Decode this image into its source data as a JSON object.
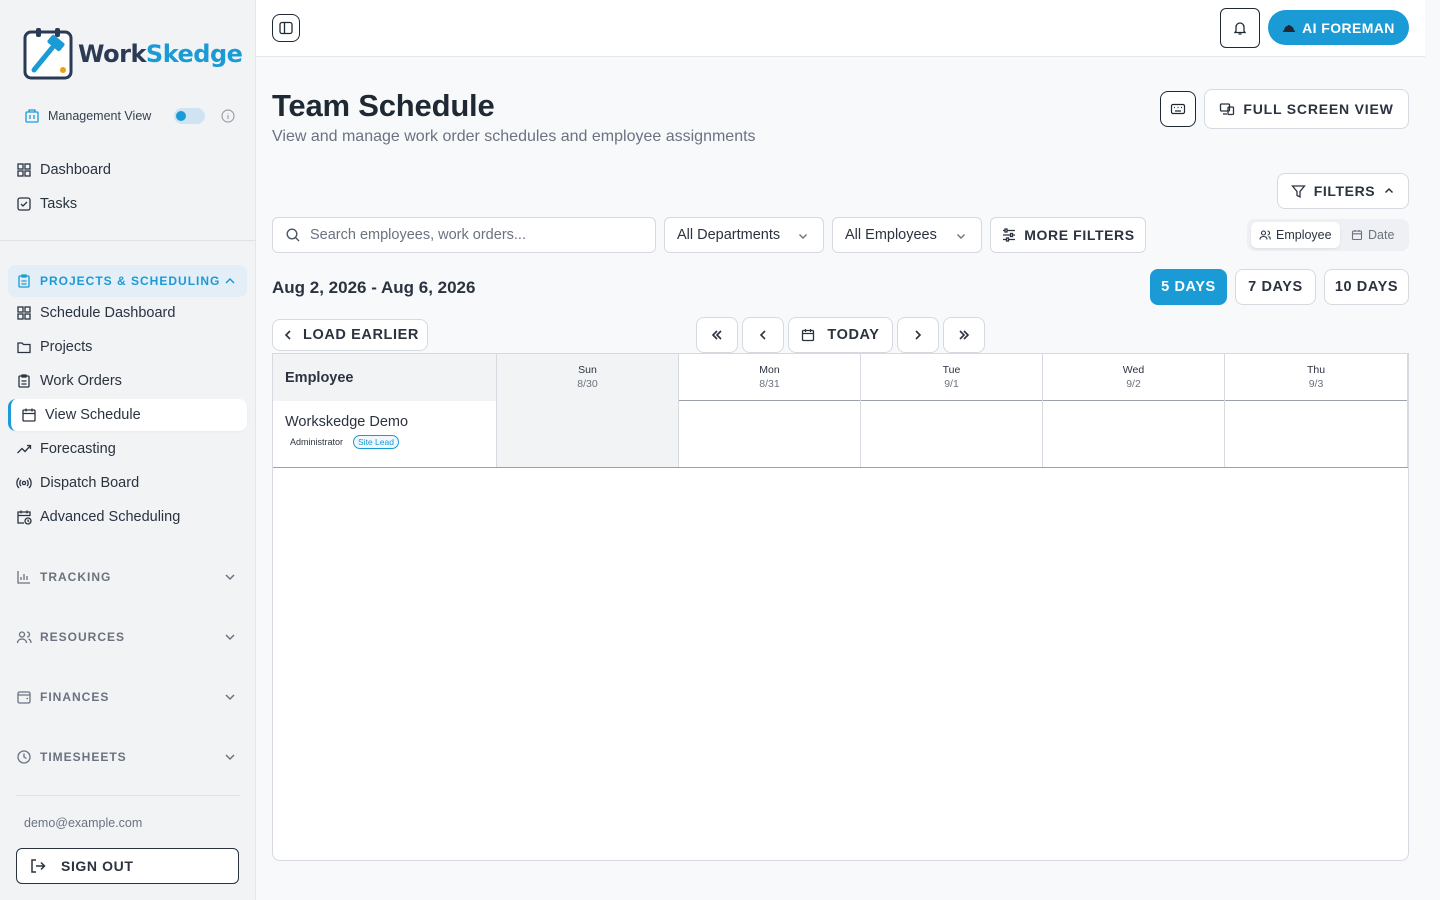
{
  "brand": {
    "name_part1": "Work",
    "name_part2": "Skedge",
    "accent": "#1a9bd6",
    "dark": "#2b3a55"
  },
  "sidebar": {
    "management_view_label": "Management View",
    "management_view_on": true,
    "top_items": [
      {
        "label": "Dashboard",
        "icon": "grid-icon"
      },
      {
        "label": "Tasks",
        "icon": "checkbox-icon"
      }
    ],
    "section_projects": {
      "title": "PROJECTS & SCHEDULING",
      "expanded": true,
      "items": [
        {
          "label": "Schedule Dashboard",
          "icon": "grid-icon"
        },
        {
          "label": "Projects",
          "icon": "folder-icon"
        },
        {
          "label": "Work Orders",
          "icon": "clipboard-icon"
        },
        {
          "label": "View Schedule",
          "icon": "calendar-icon",
          "active": true
        },
        {
          "label": "Forecasting",
          "icon": "trend-icon"
        },
        {
          "label": "Dispatch Board",
          "icon": "radio-icon"
        },
        {
          "label": "Advanced Scheduling",
          "icon": "calendar-clock-icon"
        }
      ]
    },
    "sections": [
      {
        "title": "TRACKING",
        "icon": "bar-chart-icon"
      },
      {
        "title": "RESOURCES",
        "icon": "users-icon"
      },
      {
        "title": "FINANCES",
        "icon": "wallet-icon"
      },
      {
        "title": "TIMESHEETS",
        "icon": "clock-icon"
      }
    ],
    "user_email": "demo@example.com",
    "sign_out_label": "SIGN OUT"
  },
  "topbar": {
    "ai_label": "AI FOREMAN"
  },
  "header": {
    "title": "Team Schedule",
    "subtitle": "View and manage work order schedules and employee assignments",
    "fullscreen_label": "FULL SCREEN VIEW",
    "filters_label": "FILTERS"
  },
  "filters": {
    "search_placeholder": "Search employees, work orders...",
    "departments": "All Departments",
    "employees": "All Employees",
    "more_label": "MORE FILTERS",
    "view_employee": "Employee",
    "view_date": "Date"
  },
  "range": {
    "label": "Aug 2, 2026 - Aug 6, 2026",
    "day_options": [
      "5 DAYS",
      "7 DAYS",
      "10 DAYS"
    ],
    "selected": "5 DAYS",
    "load_earlier": "LOAD EARLIER",
    "today": "TODAY"
  },
  "schedule": {
    "employee_col": "Employee",
    "days": [
      {
        "name": "Sun",
        "date": "8/30",
        "weekend": true
      },
      {
        "name": "Mon",
        "date": "8/31"
      },
      {
        "name": "Tue",
        "date": "9/1"
      },
      {
        "name": "Wed",
        "date": "9/2"
      },
      {
        "name": "Thu",
        "date": "9/3"
      }
    ],
    "rows": [
      {
        "name": "Workskedge Demo",
        "role": "Administrator",
        "badge": "Site Lead"
      }
    ]
  }
}
